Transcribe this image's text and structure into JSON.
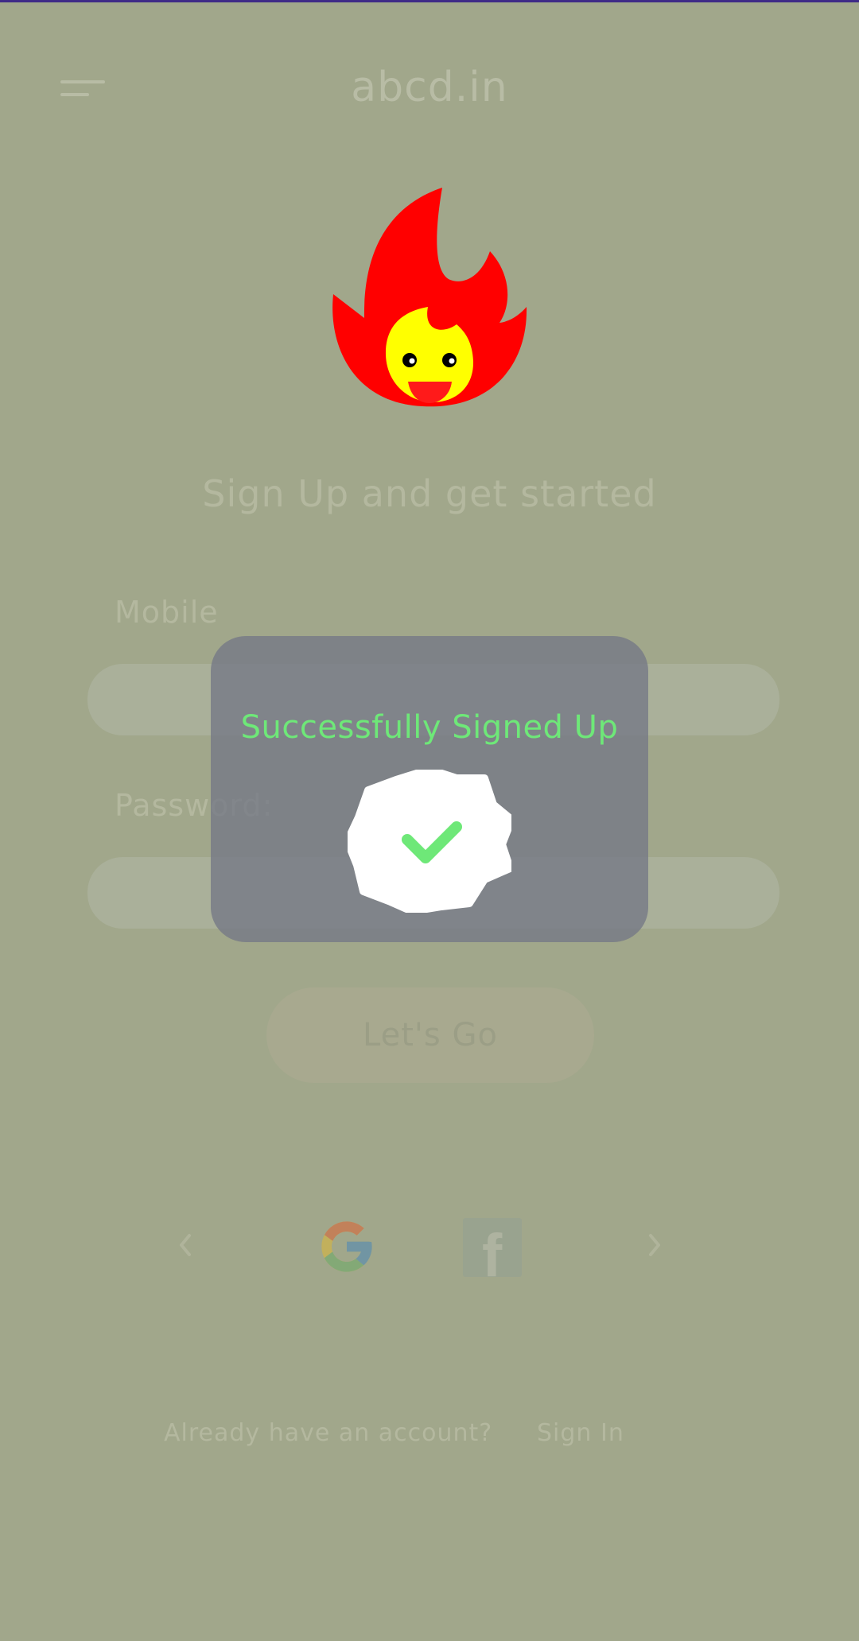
{
  "header": {
    "title": "abcd.in",
    "menu_icon": "hamburger-menu-icon"
  },
  "logo": {
    "icon": "flame-mascot-logo",
    "colors": {
      "flame": "#ff0000",
      "face": "#ffff00"
    }
  },
  "form": {
    "heading": "Sign Up and get started",
    "mobile_label": "Mobile",
    "mobile_value": "",
    "password_label": "Password:",
    "password_value": "",
    "submit_label": "Let's Go"
  },
  "social": {
    "prev_icon": "chevron-left-icon",
    "next_icon": "chevron-right-icon",
    "providers": [
      "google-icon",
      "facebook-icon"
    ]
  },
  "footer": {
    "question": "Already have an account?",
    "signin_label": "Sign In"
  },
  "dialog": {
    "message": "Successfully Signed Up",
    "icon": "verified-badge-check-icon",
    "colors": {
      "message": "#6ee878",
      "check": "#6ee878"
    }
  }
}
